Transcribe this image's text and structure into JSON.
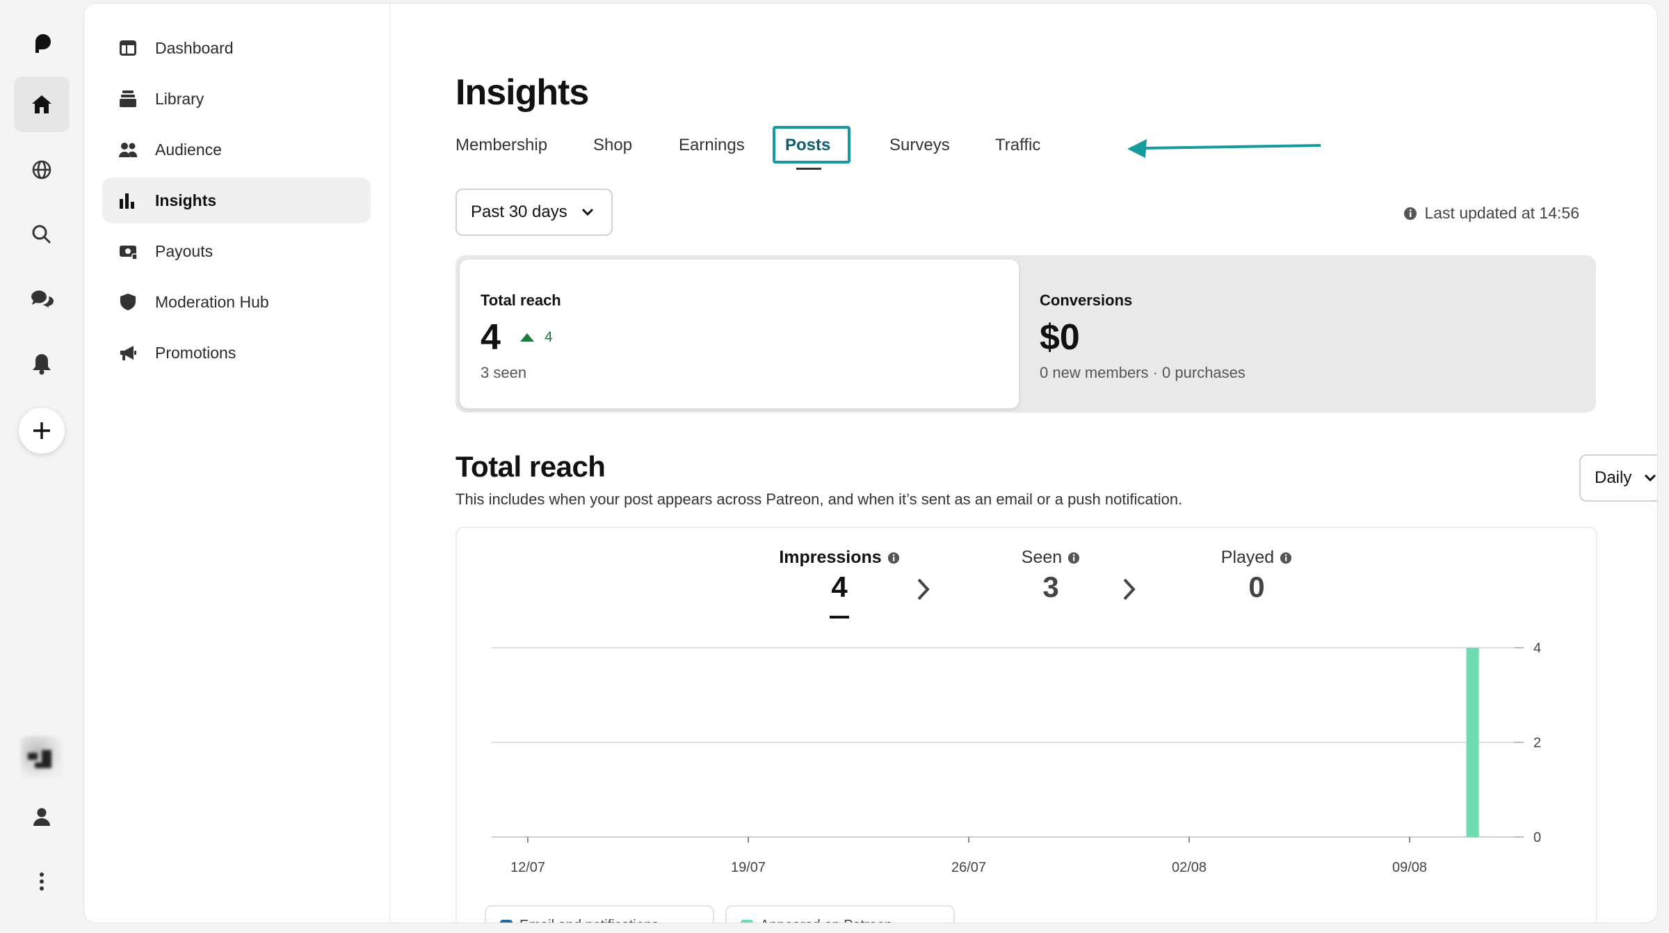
{
  "rail": {
    "icons": [
      "patreon-logo-icon",
      "home-icon",
      "globe-icon",
      "search-icon",
      "chat-icon",
      "bell-icon",
      "plus-icon",
      "avatar",
      "person-icon",
      "more-vertical-icon"
    ]
  },
  "sidebar": {
    "items": [
      {
        "label": "Dashboard",
        "icon": "dashboard-icon"
      },
      {
        "label": "Library",
        "icon": "library-icon"
      },
      {
        "label": "Audience",
        "icon": "audience-icon"
      },
      {
        "label": "Insights",
        "icon": "insights-icon",
        "active": true
      },
      {
        "label": "Payouts",
        "icon": "payouts-icon"
      },
      {
        "label": "Moderation Hub",
        "icon": "shield-icon"
      },
      {
        "label": "Promotions",
        "icon": "megaphone-icon"
      }
    ]
  },
  "page": {
    "title": "Insights",
    "tabs": [
      "Membership",
      "Shop",
      "Earnings",
      "Posts",
      "Surveys",
      "Traffic"
    ],
    "active_tab": "Posts",
    "range": "Past 30 days",
    "last_updated": "Last updated at 14:56"
  },
  "stats": {
    "reach": {
      "label": "Total reach",
      "value": "4",
      "delta": "4",
      "sub": "3 seen"
    },
    "conversions": {
      "label": "Conversions",
      "value": "$0",
      "sub": "0 new members · 0 purchases"
    }
  },
  "section": {
    "title": "Total reach",
    "description": "This includes when your post appears across Patreon, and when it’s sent as an email or a push notification.",
    "interval": "Daily"
  },
  "metrics": [
    {
      "label": "Impressions",
      "value": "4",
      "active": true
    },
    {
      "label": "Seen",
      "value": "3"
    },
    {
      "label": "Played",
      "value": "0"
    }
  ],
  "legend": [
    "Email and notifications",
    "Appeared on Patreon"
  ],
  "colors": {
    "accent": "#179a9c",
    "bar": "#6fdcaf",
    "positive": "#1f7a3f"
  },
  "chart_data": {
    "type": "bar",
    "x_tick_labels": [
      "12/07",
      "19/07",
      "26/07",
      "02/08",
      "09/08"
    ],
    "y_tick_labels": [
      "0",
      "2",
      "4"
    ],
    "ylim": [
      0,
      4
    ],
    "series": [
      {
        "name": "Impressions",
        "points": [
          {
            "x": "11/08",
            "y": 4
          }
        ]
      }
    ]
  }
}
